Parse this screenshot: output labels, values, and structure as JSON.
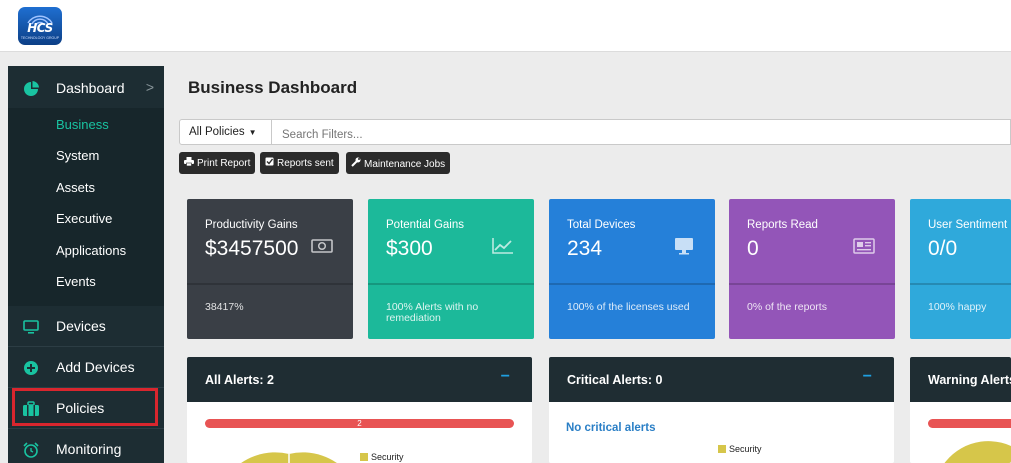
{
  "app": {
    "logo_text": "HCS",
    "logo_subtext": "TECHNOLOGY GROUP"
  },
  "sidebar": {
    "dashboard": {
      "label": "Dashboard",
      "chevron": ">"
    },
    "sub_items": [
      {
        "label": "Business",
        "active": true
      },
      {
        "label": "System"
      },
      {
        "label": "Assets"
      },
      {
        "label": "Executive"
      },
      {
        "label": "Applications"
      },
      {
        "label": "Events"
      }
    ],
    "items": [
      {
        "label": "Devices",
        "icon": "monitor-icon"
      },
      {
        "label": "Add Devices",
        "icon": "plus-circle-icon"
      },
      {
        "label": "Policies",
        "icon": "briefcase-icon",
        "highlighted": true
      },
      {
        "label": "Monitoring",
        "icon": "alarm-clock-icon"
      }
    ]
  },
  "main": {
    "title": "Business Dashboard",
    "filter": {
      "selected": "All Policies"
    },
    "search": {
      "placeholder": "Search Filters..."
    },
    "toolbar": [
      {
        "label": "Print Report",
        "icon": "print-icon"
      },
      {
        "label": "Reports sent",
        "icon": "check-square-icon"
      },
      {
        "label": "Maintenance Jobs",
        "icon": "wrench-icon"
      }
    ],
    "cards": [
      {
        "title": "Productivity Gains",
        "value": "$3457500",
        "note": "38417%",
        "color": "#3a3f46",
        "icon": "money-icon"
      },
      {
        "title": "Potential Gains",
        "value": "$300",
        "note": "100% Alerts with no remediation",
        "color": "#1cb99a",
        "icon": "line-chart-icon"
      },
      {
        "title": "Total Devices",
        "value": "234",
        "note": "100% of the licenses used",
        "color": "#2580d9",
        "icon": "desktop-icon"
      },
      {
        "title": "Reports Read",
        "value": "0",
        "note": "0% of the reports",
        "color": "#9355b8",
        "icon": "newspaper-icon"
      },
      {
        "title": "User Sentiment",
        "value": "0/0",
        "note": "100% happy",
        "color": "#2fa9db",
        "icon": ""
      }
    ],
    "panels": [
      {
        "title": "All Alerts: 2",
        "bar_label": "2",
        "legend": "Security"
      },
      {
        "title": "Critical Alerts: 0",
        "message": "No critical alerts",
        "legend": "Security"
      },
      {
        "title": "Warning Alerts"
      }
    ],
    "minimize_symbol": "−"
  }
}
